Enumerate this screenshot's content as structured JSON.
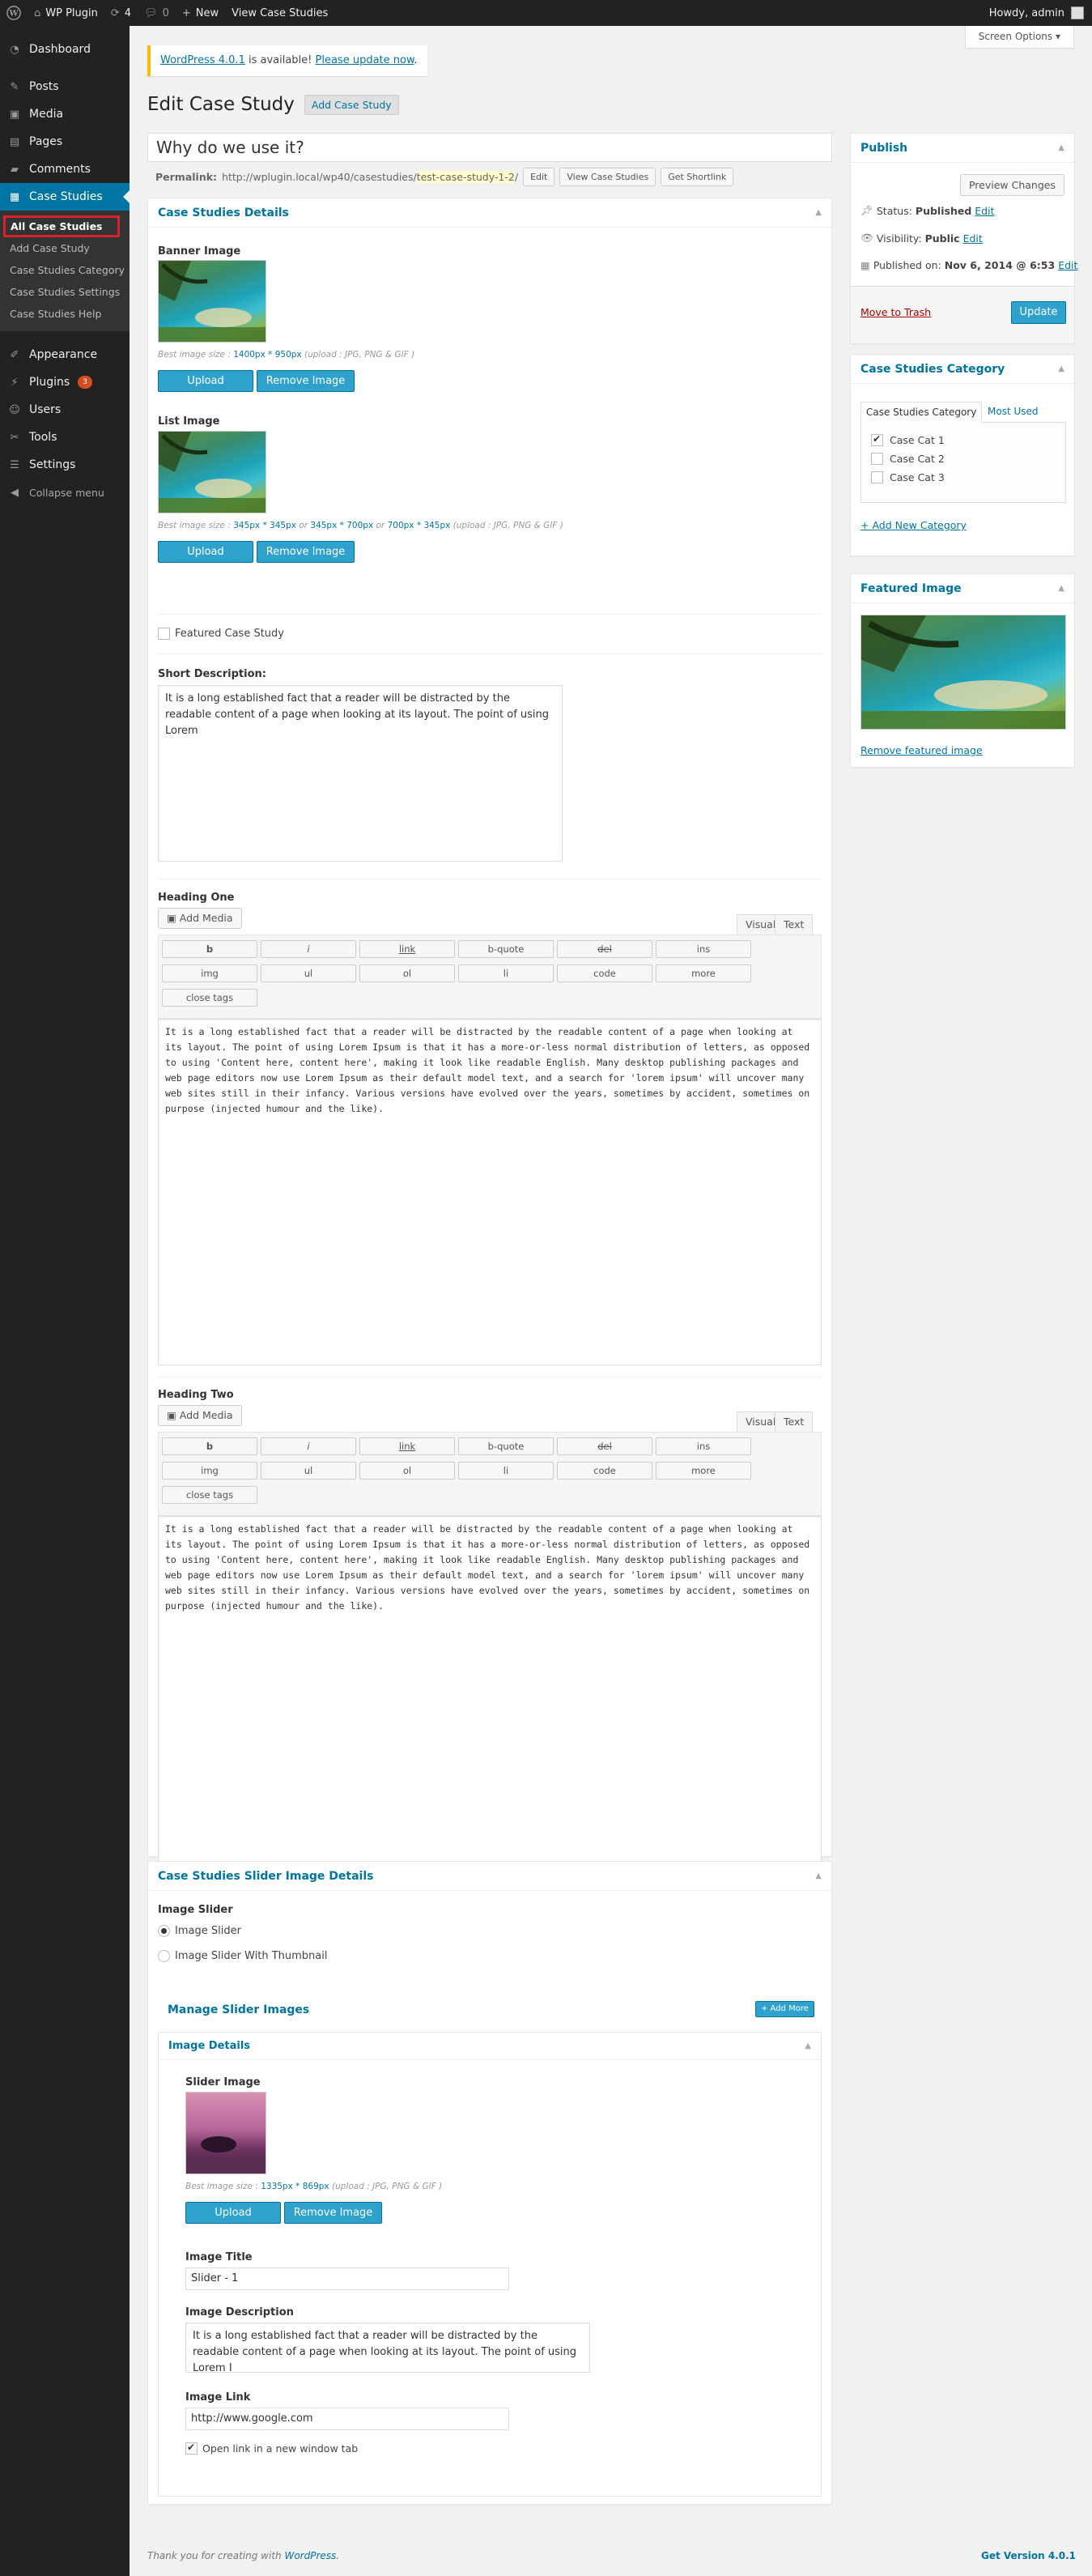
{
  "adminbar": {
    "site_name": "WP Plugin",
    "updates_count": "4",
    "comments_count": "0",
    "new_label": "New",
    "view_label": "View Case Studies",
    "howdy": "Howdy, admin"
  },
  "sidebar": {
    "items": [
      {
        "label": "Dashboard",
        "icon": "dashboard-icon"
      },
      {
        "label": "Posts",
        "icon": "pin-icon"
      },
      {
        "label": "Media",
        "icon": "media-icon"
      },
      {
        "label": "Pages",
        "icon": "page-icon"
      },
      {
        "label": "Comments",
        "icon": "comment-icon"
      },
      {
        "label": "Case Studies",
        "icon": "grid-icon"
      },
      {
        "label": "Appearance",
        "icon": "brush-icon"
      },
      {
        "label": "Plugins",
        "icon": "plug-icon",
        "badge": "3"
      },
      {
        "label": "Users",
        "icon": "users-icon"
      },
      {
        "label": "Tools",
        "icon": "wrench-icon"
      },
      {
        "label": "Settings",
        "icon": "sliders-icon"
      },
      {
        "label": "Collapse menu",
        "icon": "collapse-icon"
      }
    ],
    "submenu": [
      "All Case Studies",
      "Add Case Study",
      "Case Studies Category",
      "Case Studies Settings",
      "Case Studies Help"
    ]
  },
  "screen_options": "Screen Options ▾",
  "notice": {
    "link1": "WordPress 4.0.1",
    "mid": " is available! ",
    "link2": "Please update now",
    "end": "."
  },
  "page": {
    "title": "Edit Case Study",
    "add_button": "Add Case Study"
  },
  "post_title": "Why do we use it?",
  "permalink": {
    "label": "Permalink:",
    "base": "http://wplugin.local/wp40/casestudies/",
    "slug": "test-case-study-1-2",
    "tail": "/",
    "buttons": [
      "Edit",
      "View Case Studies",
      "Get Shortlink"
    ]
  },
  "details": {
    "title": "Case Studies Details",
    "banner_label": "Banner Image",
    "banner_hint_pre": "Best image size : ",
    "banner_hint_size": "1400px * 950px",
    "banner_hint_post": " (upload : JPG, PNG & GIF )",
    "list_label": "List Image",
    "list_hint_pre": "Best image size : ",
    "list_hint_s1": "345px * 345px",
    "list_hint_or1": " or ",
    "list_hint_s2": "345px * 700px",
    "list_hint_or2": " or ",
    "list_hint_s3": "700px * 345px",
    "list_hint_post": " (upload : JPG, PNG & GIF )",
    "upload": "Upload",
    "remove": "Remove Image",
    "featured_label": "Featured Case Study",
    "short_desc_label": "Short Description:",
    "short_desc": "It is a long established fact that a reader will be distracted by the readable content of a page when looking at its layout. The point of using Lorem"
  },
  "editor": {
    "add_media": "Add Media",
    "visual": "Visual",
    "text": "Text",
    "buttons_row1": [
      "b",
      "i",
      "link",
      "b-quote",
      "del",
      "ins"
    ],
    "buttons_row2": [
      "img",
      "ul",
      "ol",
      "li",
      "code",
      "more"
    ],
    "close_tags": "close tags",
    "heading_one": "Heading One",
    "heading_two": "Heading Two",
    "content": "It is a long established fact that a reader will be distracted by the readable content of a page when looking at its layout. The point of using Lorem Ipsum is that it has a more-or-less normal distribution of letters, as opposed to using 'Content here, content here', making it look like readable English. Many desktop publishing packages and web page editors now use Lorem Ipsum as their default model text, and a search for 'lorem ipsum' will uncover many web sites still in their infancy. Various versions have evolved over the years, sometimes by accident, sometimes on purpose (injected humour and the like)."
  },
  "slider": {
    "title": "Case Studies Slider Image Details",
    "label": "Image Slider",
    "opt1": "Image Slider",
    "opt2": "Image Slider With Thumbnail",
    "manage": "Manage Slider Images",
    "add_more": "+ Add More",
    "image_details": "Image Details",
    "slider_image_label": "Slider Image",
    "hint_pre": "Best image size : ",
    "hint_size": "1335px * 869px",
    "hint_post": " (upload : JPG, PNG & GIF )",
    "upload": "Upload",
    "remove": "Remove Image",
    "image_title_label": "Image Title",
    "image_title": "Slider - 1",
    "image_desc_label": "Image Description",
    "image_desc": "It is a long established fact that a reader will be distracted by the readable content of a page when looking at its layout. The point of using Lorem I",
    "image_link_label": "Image Link",
    "image_link": "http://www.google.com",
    "new_tab_label": "Open link in a new window tab"
  },
  "publish": {
    "title": "Publish",
    "preview": "Preview Changes",
    "status_label": "Status: ",
    "status": "Published",
    "visibility_label": "Visibility: ",
    "visibility": "Public",
    "published_label": "Published on: ",
    "published": "Nov 6, 2014 @ 6:53",
    "edit": "Edit",
    "trash": "Move to Trash",
    "update": "Update"
  },
  "category": {
    "title": "Case Studies Category",
    "tab_all": "Case Studies Category",
    "tab_used": "Most Used",
    "cats": [
      "Case Cat 1",
      "Case Cat 2",
      "Case Cat 3"
    ],
    "add_new": "+ Add New Category"
  },
  "featured": {
    "title": "Featured Image",
    "remove": "Remove featured image"
  },
  "footer": {
    "thanks_pre": "Thank you for creating with ",
    "thanks_link": "WordPress",
    "thanks_post": ".",
    "version": "Get Version 4.0.1"
  },
  "colors": {
    "accent": "#0074a2",
    "button": "#2ea2cc",
    "sidebar": "#222222",
    "trash": "#a00000",
    "notice": "#ffba00"
  }
}
